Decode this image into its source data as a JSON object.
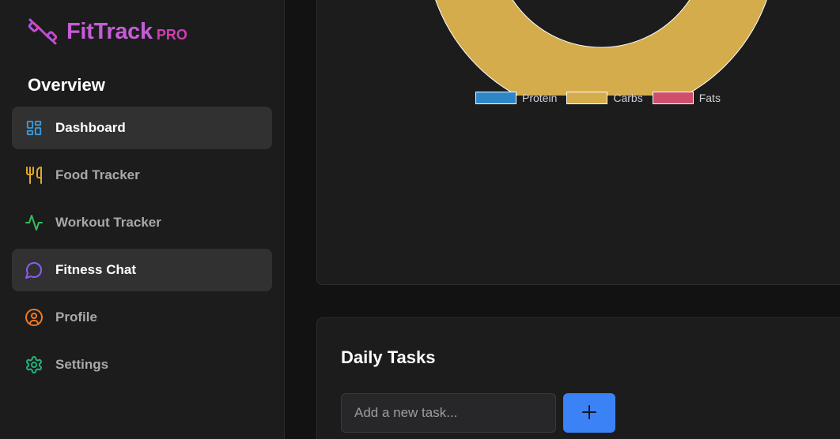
{
  "brand": {
    "name": "FitTrack",
    "badge": "PRO",
    "icon": "dumbbell-icon"
  },
  "sidebar": {
    "section_title": "Overview",
    "items": [
      {
        "label": "Dashboard",
        "icon": "dashboard-icon",
        "color": "#3b9bd9",
        "active": true
      },
      {
        "label": "Food Tracker",
        "icon": "utensils-icon",
        "color": "#e2a824",
        "active": false
      },
      {
        "label": "Workout Tracker",
        "icon": "activity-icon",
        "color": "#2fbf5a",
        "active": false
      },
      {
        "label": "Fitness Chat",
        "icon": "chat-icon",
        "color": "#8b5cf6",
        "active": true
      },
      {
        "label": "Profile",
        "icon": "user-circle-icon",
        "color": "#f07a22",
        "active": false
      },
      {
        "label": "Settings",
        "icon": "gear-icon",
        "color": "#22b37a",
        "active": false
      }
    ]
  },
  "chart_data": {
    "type": "pie",
    "categories": [
      "Protein",
      "Carbs",
      "Fats"
    ],
    "colors": [
      "#2f86c6",
      "#d4ac4c",
      "#cf4f6a"
    ],
    "legend_position": "bottom"
  },
  "tasks": {
    "title": "Daily Tasks",
    "input_placeholder": "Add a new task...",
    "add_button_icon": "plus-icon",
    "accent": "#3b82f6"
  }
}
